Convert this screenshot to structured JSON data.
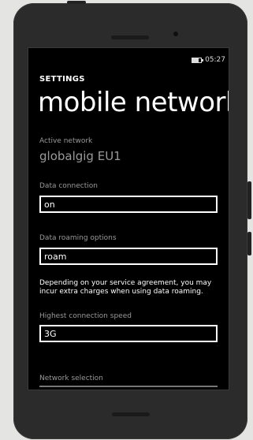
{
  "status": {
    "time": "05:27",
    "battery_icon": "battery-icon"
  },
  "header": {
    "app": "SETTINGS",
    "title": "mobile network"
  },
  "active_network": {
    "label": "Active network",
    "value": "globalgig EU1"
  },
  "data_connection": {
    "label": "Data connection",
    "value": "on"
  },
  "data_roaming": {
    "label": "Data roaming options",
    "value": "roam",
    "note": "Depending on your service agreement, you may incur extra charges when using data roaming."
  },
  "connection_speed": {
    "label": "Highest connection speed",
    "value": "3G"
  },
  "network_selection": {
    "label": "Network selection"
  }
}
